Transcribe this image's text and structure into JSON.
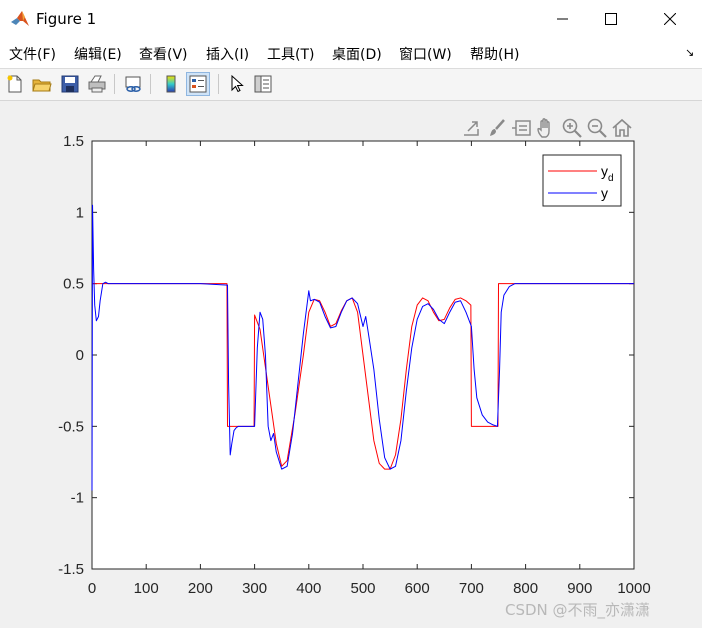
{
  "window": {
    "title": "Figure 1",
    "icon": "matlab-icon",
    "controls": [
      "minimize-icon",
      "maximize-icon",
      "close-icon"
    ]
  },
  "menu": {
    "items": [
      "文件(F)",
      "编辑(E)",
      "查看(V)",
      "插入(I)",
      "工具(T)",
      "桌面(D)",
      "窗口(W)",
      "帮助(H)"
    ],
    "dock_arrow": "↘"
  },
  "toolbar": {
    "buttons": [
      "new-figure-icon",
      "open-file-icon",
      "save-icon",
      "print-icon",
      "link-plot-icon",
      "colorbar-icon",
      "legend-icon",
      "pointer-icon",
      "property-inspector-icon"
    ],
    "active": "legend-icon"
  },
  "axes_toolbar": [
    "export-icon",
    "brush-icon",
    "data-tips-icon",
    "pan-icon",
    "zoom-in-icon",
    "zoom-out-icon",
    "home-icon"
  ],
  "colors": {
    "yd": "#ff0000",
    "y": "#0000ff"
  },
  "chart_data": {
    "type": "line",
    "title": "",
    "xlabel": "",
    "ylabel": "",
    "xlim": [
      0,
      1000
    ],
    "ylim": [
      -1.5,
      1.5
    ],
    "xticks": [
      "0",
      "100",
      "200",
      "300",
      "400",
      "500",
      "600",
      "700",
      "800",
      "900",
      "1000"
    ],
    "yticks": [
      "1.5",
      "1",
      "0.5",
      "0",
      "-0.5",
      "-1",
      "-1.5"
    ],
    "grid": false,
    "legend_position": "top-right",
    "series": [
      {
        "name": "y_d",
        "label_main": "y",
        "label_sub": "d",
        "color": "#ff0000",
        "x": [
          0,
          50,
          100,
          150,
          200,
          249,
          250,
          280,
          299,
          300,
          310,
          325,
          340,
          350,
          360,
          375,
          390,
          400,
          410,
          420,
          430,
          440,
          450,
          460,
          470,
          480,
          490,
          500,
          510,
          520,
          530,
          540,
          550,
          560,
          570,
          580,
          590,
          600,
          610,
          620,
          630,
          640,
          650,
          660,
          670,
          680,
          690,
          699,
          700,
          730,
          749,
          750,
          800,
          900,
          1000
        ],
        "y": [
          0.5,
          0.5,
          0.5,
          0.5,
          0.5,
          0.5,
          -0.5,
          -0.5,
          -0.5,
          0.28,
          0.18,
          -0.22,
          -0.62,
          -0.78,
          -0.74,
          -0.4,
          0.0,
          0.3,
          0.39,
          0.38,
          0.3,
          0.2,
          0.22,
          0.31,
          0.38,
          0.4,
          0.3,
          0.0,
          -0.3,
          -0.6,
          -0.76,
          -0.8,
          -0.8,
          -0.7,
          -0.45,
          -0.1,
          0.2,
          0.35,
          0.4,
          0.38,
          0.3,
          0.24,
          0.25,
          0.33,
          0.39,
          0.4,
          0.38,
          0.35,
          -0.5,
          -0.5,
          -0.5,
          0.5,
          0.5,
          0.5,
          0.5
        ]
      },
      {
        "name": "y",
        "label_main": "y",
        "label_sub": "",
        "color": "#0000ff",
        "x": [
          0,
          1,
          3,
          5,
          8,
          12,
          15,
          20,
          25,
          30,
          100,
          200,
          250,
          252,
          255,
          258,
          262,
          266,
          270,
          280,
          290,
          300,
          305,
          310,
          315,
          320,
          325,
          330,
          335,
          340,
          350,
          360,
          370,
          380,
          390,
          395,
          400,
          403,
          410,
          420,
          430,
          440,
          450,
          460,
          470,
          480,
          490,
          500,
          505,
          510,
          520,
          530,
          540,
          550,
          560,
          570,
          580,
          590,
          600,
          610,
          620,
          630,
          640,
          650,
          660,
          670,
          680,
          690,
          700,
          705,
          710,
          720,
          730,
          740,
          748,
          752,
          755,
          760,
          770,
          780,
          800,
          900,
          1000
        ],
        "y": [
          -0.95,
          1.05,
          0.6,
          0.35,
          0.24,
          0.27,
          0.38,
          0.5,
          0.51,
          0.5,
          0.5,
          0.5,
          0.49,
          -0.2,
          -0.7,
          -0.62,
          -0.53,
          -0.51,
          -0.5,
          -0.5,
          -0.5,
          -0.5,
          0.05,
          0.3,
          0.25,
          0.0,
          -0.5,
          -0.6,
          -0.55,
          -0.68,
          -0.8,
          -0.78,
          -0.55,
          -0.2,
          0.15,
          0.3,
          0.45,
          0.38,
          0.39,
          0.37,
          0.27,
          0.19,
          0.2,
          0.3,
          0.38,
          0.4,
          0.36,
          0.2,
          0.27,
          0.15,
          -0.1,
          -0.45,
          -0.72,
          -0.8,
          -0.78,
          -0.6,
          -0.25,
          0.05,
          0.25,
          0.34,
          0.36,
          0.32,
          0.25,
          0.22,
          0.3,
          0.37,
          0.38,
          0.3,
          0.2,
          -0.1,
          -0.3,
          -0.42,
          -0.47,
          -0.49,
          -0.5,
          -0.1,
          0.3,
          0.42,
          0.48,
          0.5,
          0.5,
          0.5,
          0.5
        ]
      }
    ]
  },
  "watermark": "CSDN @不雨_亦潇潇"
}
